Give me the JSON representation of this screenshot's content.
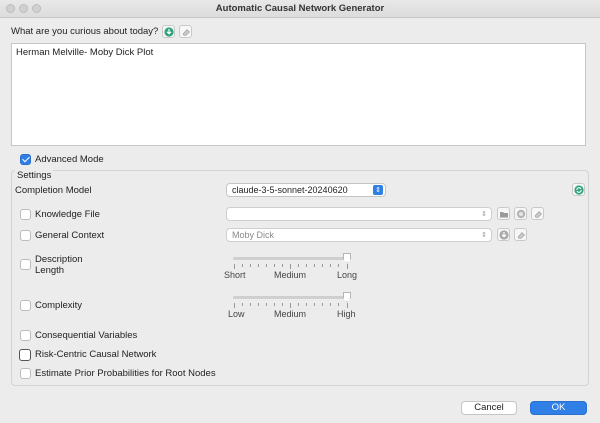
{
  "window": {
    "title": "Automatic Causal Network Generator"
  },
  "prompt": {
    "label": "What are you curious about today?",
    "value": "Herman Melville- Moby Dick Plot"
  },
  "advanced_mode": {
    "label": "Advanced Mode",
    "checked": true
  },
  "settings": {
    "legend": "Settings",
    "completion_model": {
      "label": "Completion Model",
      "value": "claude-3-5-sonnet-20240620"
    },
    "knowledge_file": {
      "label": "Knowledge File",
      "value": ""
    },
    "general_context": {
      "label": "General Context",
      "value": "Moby Dick"
    },
    "description_length": {
      "label_line1": "Description",
      "label_line2": "Length",
      "ticks": [
        "Short",
        "Medium",
        "Long"
      ],
      "value": "Long"
    },
    "complexity": {
      "label": "Complexity",
      "ticks": [
        "Low",
        "Medium",
        "High"
      ],
      "value": "High"
    },
    "consequential_variables": {
      "label": "Consequential Variables"
    },
    "risk_centric": {
      "label": "Risk-Centric Causal Network"
    },
    "prior_probabilities": {
      "label": "Estimate Prior Probabilities for Root Nodes"
    }
  },
  "buttons": {
    "cancel": "Cancel",
    "ok": "OK"
  },
  "colors": {
    "accent": "#2f7fe6",
    "teal_icon": "#2fa37a",
    "window_bg": "#ececec"
  }
}
